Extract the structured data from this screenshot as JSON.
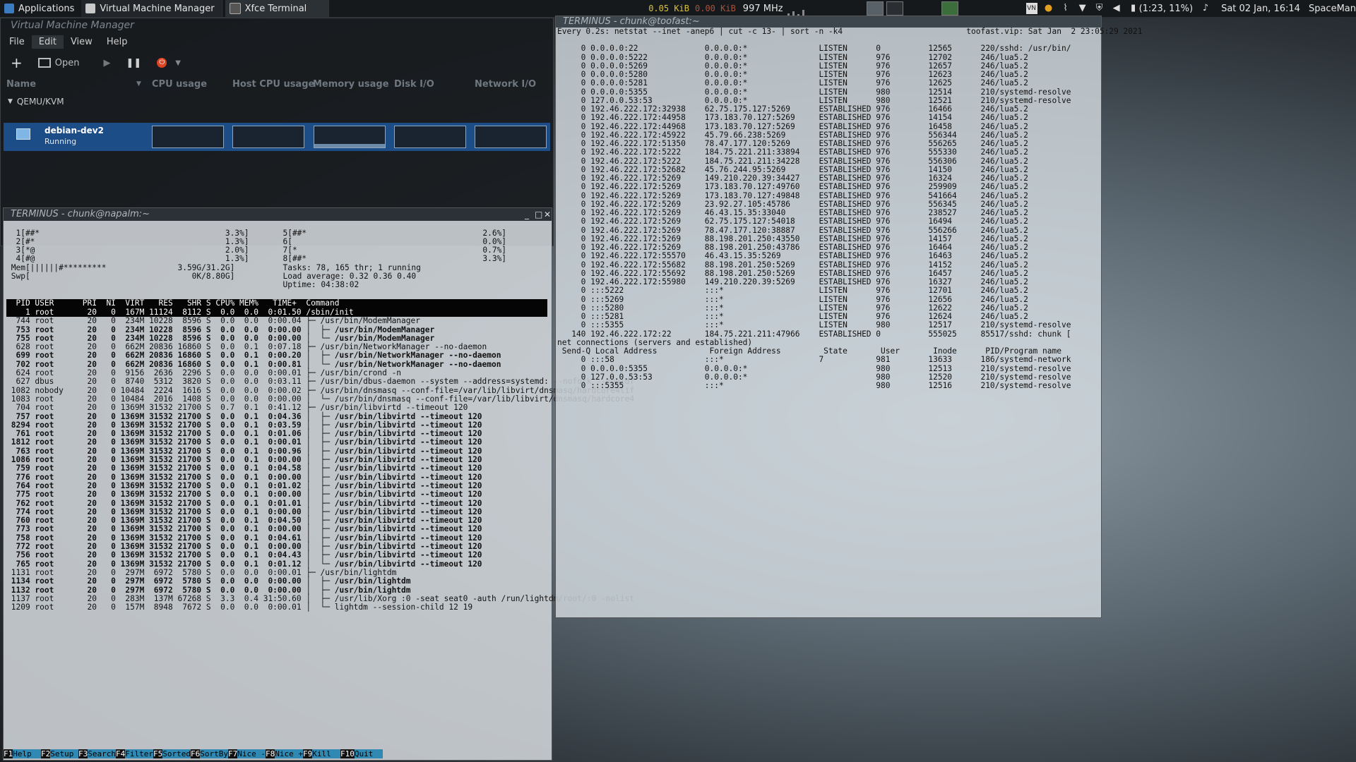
{
  "panel": {
    "applications": "Applications",
    "tasks": [
      "Virtual Machine Manager",
      "Xfce Terminal"
    ],
    "net_down": "0.05 KiB",
    "net_up": "0.00 KiB",
    "cpu_freq": "997 MHz",
    "battery": "(1:23, 11%)",
    "clock": "Sat 02 Jan, 16:14",
    "user": "SpaceMan"
  },
  "vmm": {
    "title": "Virtual Machine Manager",
    "menu": [
      "File",
      "Edit",
      "View",
      "Help"
    ],
    "toolbar_open": "Open",
    "columns": [
      "Name",
      "CPU usage",
      "Host CPU usage",
      "Memory usage",
      "Disk I/O",
      "Network I/O"
    ],
    "group": "QEMU/KVM",
    "vm_name": "debian-dev2",
    "vm_state": "Running"
  },
  "htop": {
    "title": "TERMINUS - chunk@napalm:~",
    "meters_left": [
      "  1[##*                                       3.3%]",
      "  2[#*                                        1.3%]",
      "  3[*@                                        2.0%]",
      "  4[#@                                        1.3%]",
      " Mem[||||||#*********               3.59G/31.2G]",
      " Swp[                                  0K/8.80G]"
    ],
    "meters_right": [
      "  5[##*                                     2.6%]",
      "  6[                                        0.0%]",
      "  7[*                                       0.7%]",
      "  8[##*                                     3.3%]",
      "  Tasks: 78, 165 thr; 1 running",
      "  Load average: 0.32 0.36 0.40",
      "  Uptime: 04:38:02"
    ],
    "header": "  PID USER      PRI  NI  VIRT   RES   SHR S CPU% MEM%   TIME+  Command",
    "rows": [
      "    1 root       20   0  167M 11124  8112 S  0.0  0.0  0:01.50 /sbin/init",
      "  744 root       20   0  234M 10228  8596 S  0.0  0.0  0:00.04 ├─ /usr/bin/ModemManager",
      "  753 root       20   0  234M 10228  8596 S  0.0  0.0  0:00.00 │  ├─ /usr/bin/ModemManager",
      "  755 root       20   0  234M 10228  8596 S  0.0  0.0  0:00.00 │  └─ /usr/bin/ModemManager",
      "  628 root       20   0  662M 20836 16860 S  0.0  0.1  0:07.18 ├─ /usr/bin/NetworkManager --no-daemon",
      "  699 root       20   0  662M 20836 16860 S  0.0  0.1  0:00.20 │  ├─ /usr/bin/NetworkManager --no-daemon",
      "  702 root       20   0  662M 20836 16860 S  0.0  0.1  0:00.81 │  └─ /usr/bin/NetworkManager --no-daemon",
      "  624 root       20   0  9156  2636  2296 S  0.0  0.0  0:00.01 ├─ /usr/bin/crond -n",
      "  627 dbus       20   0  8740  5312  3820 S  0.0  0.0  0:03.11 ├─ /usr/bin/dbus-daemon --system --address=systemd: --nofork --nopidf",
      " 1082 nobody     20   0 10484  2224  1616 S  0.0  0.0  0:00.02 ├─ /usr/bin/dnsmasq --conf-file=/var/lib/libvirt/dnsmasq/hardcore4lif",
      " 1083 root       20   0 10484  2016  1408 S  0.0  0.0  0:00.00 │  └─ /usr/bin/dnsmasq --conf-file=/var/lib/libvirt/dnsmasq/hardcore4",
      "  704 root       20   0 1369M 31532 21700 S  0.7  0.1  0:41.12 ├─ /usr/bin/libvirtd --timeout 120",
      "  757 root       20   0 1369M 31532 21700 S  0.0  0.1  0:04.36 │  ├─ /usr/bin/libvirtd --timeout 120",
      " 8294 root       20   0 1369M 31532 21700 S  0.0  0.1  0:03.59 │  ├─ /usr/bin/libvirtd --timeout 120",
      "  761 root       20   0 1369M 31532 21700 S  0.0  0.1  0:01.06 │  ├─ /usr/bin/libvirtd --timeout 120",
      " 1812 root       20   0 1369M 31532 21700 S  0.0  0.1  0:00.01 │  ├─ /usr/bin/libvirtd --timeout 120",
      "  763 root       20   0 1369M 31532 21700 S  0.0  0.1  0:00.96 │  ├─ /usr/bin/libvirtd --timeout 120",
      " 1086 root       20   0 1369M 31532 21700 S  0.0  0.1  0:00.00 │  ├─ /usr/bin/libvirtd --timeout 120",
      "  759 root       20   0 1369M 31532 21700 S  0.0  0.1  0:04.58 │  ├─ /usr/bin/libvirtd --timeout 120",
      "  776 root       20   0 1369M 31532 21700 S  0.0  0.1  0:00.00 │  ├─ /usr/bin/libvirtd --timeout 120",
      "  764 root       20   0 1369M 31532 21700 S  0.0  0.1  0:01.02 │  ├─ /usr/bin/libvirtd --timeout 120",
      "  775 root       20   0 1369M 31532 21700 S  0.0  0.1  0:00.00 │  ├─ /usr/bin/libvirtd --timeout 120",
      "  762 root       20   0 1369M 31532 21700 S  0.0  0.1  0:01.01 │  ├─ /usr/bin/libvirtd --timeout 120",
      "  774 root       20   0 1369M 31532 21700 S  0.0  0.1  0:00.00 │  ├─ /usr/bin/libvirtd --timeout 120",
      "  760 root       20   0 1369M 31532 21700 S  0.0  0.1  0:04.50 │  ├─ /usr/bin/libvirtd --timeout 120",
      "  773 root       20   0 1369M 31532 21700 S  0.0  0.1  0:00.00 │  ├─ /usr/bin/libvirtd --timeout 120",
      "  758 root       20   0 1369M 31532 21700 S  0.0  0.1  0:04.61 │  ├─ /usr/bin/libvirtd --timeout 120",
      "  772 root       20   0 1369M 31532 21700 S  0.0  0.1  0:00.00 │  ├─ /usr/bin/libvirtd --timeout 120",
      "  756 root       20   0 1369M 31532 21700 S  0.0  0.1  0:04.43 │  ├─ /usr/bin/libvirtd --timeout 120",
      "  765 root       20   0 1369M 31532 21700 S  0.0  0.1  0:01.12 │  └─ /usr/bin/libvirtd --timeout 120",
      " 1131 root       20   0  297M  6972  5780 S  0.0  0.0  0:00.01 ├─ /usr/bin/lightdm",
      " 1134 root       20   0  297M  6972  5780 S  0.0  0.0  0:00.00 │  ├─ /usr/bin/lightdm",
      " 1132 root       20   0  297M  6972  5780 S  0.0  0.0  0:00.00 │  ├─ /usr/bin/lightdm",
      " 1137 root       20   0  283M  137M 67268 S  3.3  0.4 31:50.60 │  ├─ /usr/lib/Xorg :0 -seat seat0 -auth /run/lightdm/root/:0 -nolist",
      " 1209 root       20   0  157M  8948  7672 S  0.0  0.0  0:00.01 │  └─ lightdm --session-child 12 19"
    ],
    "fkeys": [
      {
        "key": "F1",
        "label": "Help  "
      },
      {
        "key": "F2",
        "label": "Setup "
      },
      {
        "key": "F3",
        "label": "Search"
      },
      {
        "key": "F4",
        "label": "Filter"
      },
      {
        "key": "F5",
        "label": "Sorted"
      },
      {
        "key": "F6",
        "label": "SortBy"
      },
      {
        "key": "F7",
        "label": "Nice -"
      },
      {
        "key": "F8",
        "label": "Nice +"
      },
      {
        "key": "F9",
        "label": "Kill  "
      },
      {
        "key": "F10",
        "label": "Quit  "
      }
    ]
  },
  "netstat": {
    "title": "TERMINUS - chunk@toofast:~",
    "header": "Every 0.2s: netstat --inet -anep6 | cut -c 13- | sort -n -k4                          toofast.vip: Sat Jan  2 23:05:29 2021",
    "lines": [
      "     0 0.0.0.0:22              0.0.0.0:*               LISTEN      0          12565      220/sshd: /usr/bin/",
      "     0 0.0.0.0:5222            0.0.0.0:*               LISTEN      976        12702      246/lua5.2",
      "     0 0.0.0.0:5269            0.0.0.0:*               LISTEN      976        12657      246/lua5.2",
      "     0 0.0.0.0:5280            0.0.0.0:*               LISTEN      976        12623      246/lua5.2",
      "     0 0.0.0.0:5281            0.0.0.0:*               LISTEN      976        12625      246/lua5.2",
      "     0 0.0.0.0:5355            0.0.0.0:*               LISTEN      980        12514      210/systemd-resolve",
      "     0 127.0.0.53:53           0.0.0.0:*               LISTEN      980        12521      210/systemd-resolve",
      "     0 192.46.222.172:32938    62.75.175.127:5269      ESTABLISHED 976        16466      246/lua5.2",
      "     0 192.46.222.172:44958    173.183.70.127:5269     ESTABLISHED 976        14154      246/lua5.2",
      "     0 192.46.222.172:44968    173.183.70.127:5269     ESTABLISHED 976        16458      246/lua5.2",
      "     0 192.46.222.172:45922    45.79.66.238:5269       ESTABLISHED 976        556344     246/lua5.2",
      "     0 192.46.222.172:51350    78.47.177.120:5269      ESTABLISHED 976        556265     246/lua5.2",
      "     0 192.46.222.172:5222     184.75.221.211:33894    ESTABLISHED 976        555330     246/lua5.2",
      "     0 192.46.222.172:5222     184.75.221.211:34228    ESTABLISHED 976        556306     246/lua5.2",
      "     0 192.46.222.172:52682    45.76.244.95:5269       ESTABLISHED 976        14150      246/lua5.2",
      "     0 192.46.222.172:5269     149.210.220.39:34427    ESTABLISHED 976        16324      246/lua5.2",
      "     0 192.46.222.172:5269     173.183.70.127:49760    ESTABLISHED 976        259909     246/lua5.2",
      "     0 192.46.222.172:5269     173.183.70.127:49848    ESTABLISHED 976        541664     246/lua5.2",
      "     0 192.46.222.172:5269     23.92.27.105:45786      ESTABLISHED 976        556345     246/lua5.2",
      "     0 192.46.222.172:5269     46.43.15.35:33040       ESTABLISHED 976        238527     246/lua5.2",
      "     0 192.46.222.172:5269     62.75.175.127:54018     ESTABLISHED 976        16494      246/lua5.2",
      "     0 192.46.222.172:5269     78.47.177.120:38887     ESTABLISHED 976        556266     246/lua5.2",
      "     0 192.46.222.172:5269     88.198.201.250:43550    ESTABLISHED 976        14157      246/lua5.2",
      "     0 192.46.222.172:5269     88.198.201.250:43786    ESTABLISHED 976        16464      246/lua5.2",
      "     0 192.46.222.172:55570    46.43.15.35:5269        ESTABLISHED 976        16463      246/lua5.2",
      "     0 192.46.222.172:55682    88.198.201.250:5269     ESTABLISHED 976        14152      246/lua5.2",
      "     0 192.46.222.172:55692    88.198.201.250:5269     ESTABLISHED 976        16457      246/lua5.2",
      "     0 192.46.222.172:55980    149.210.220.39:5269     ESTABLISHED 976        16327      246/lua5.2",
      "     0 :::5222                 :::*                    LISTEN      976        12701      246/lua5.2",
      "     0 :::5269                 :::*                    LISTEN      976        12656      246/lua5.2",
      "     0 :::5280                 :::*                    LISTEN      976        12622      246/lua5.2",
      "     0 :::5281                 :::*                    LISTEN      976        12624      246/lua5.2",
      "     0 :::5355                 :::*                    LISTEN      980        12517      210/systemd-resolve",
      "   140 192.46.222.172:22       184.75.221.211:47966    ESTABLISHED 0          555025     85517/sshd: chunk [",
      "net connections (servers and established)",
      " Send-Q Local Address           Foreign Address         State       User       Inode      PID/Program name",
      "     0 :::58                   :::*                    7           981        13633      186/systemd-network",
      "     0 0.0.0.0:5355            0.0.0.0:*                           980        12513      210/systemd-resolve",
      "     0 127.0.0.53:53           0.0.0.0:*                           980        12520      210/systemd-resolve",
      "     0 :::5355                 :::*                                980        12516      210/systemd-resolve"
    ]
  }
}
